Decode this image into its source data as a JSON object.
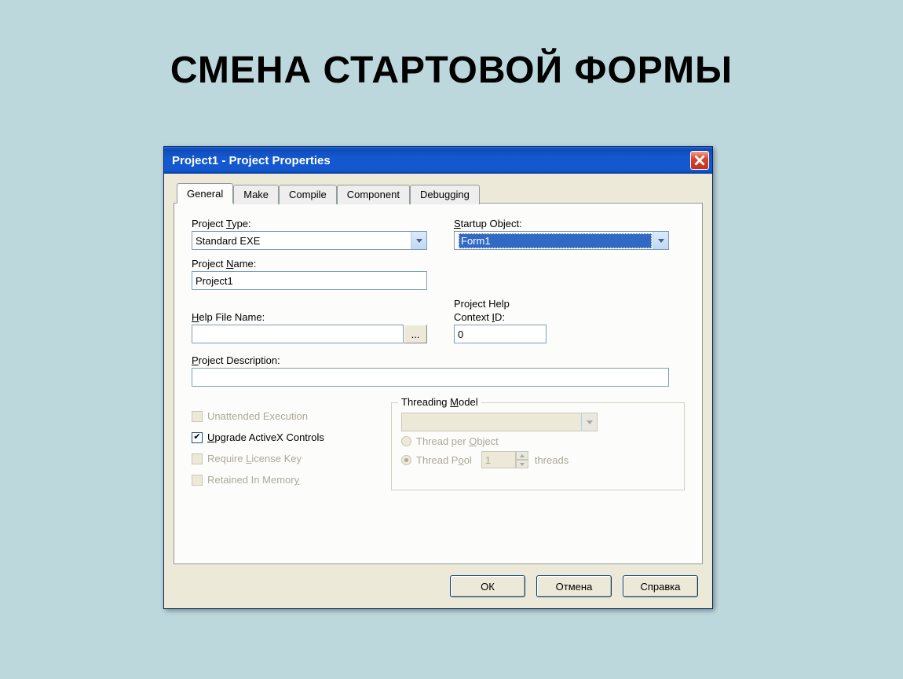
{
  "slide": {
    "title": "СМЕНА СТАРТОВОЙ ФОРМЫ"
  },
  "titlebar": {
    "text": "Project1 - Project Properties"
  },
  "tabs": {
    "general": "General",
    "make": "Make",
    "compile": "Compile",
    "component": "Component",
    "debugging": "Debugging"
  },
  "labels": {
    "project_type": "Project Type:",
    "project_type_u": "T",
    "startup_object": "Startup Object:",
    "startup_object_u": "S",
    "project_name": "Project Name:",
    "project_name_u": "N",
    "help_file_name": "Help File Name:",
    "help_file_u": "H",
    "project_help_context": "Project Help",
    "context_id": "Context ID:",
    "context_id_u": "I",
    "project_description": "Project Description:",
    "project_description_u": "P",
    "unattended": "Unattended Execution",
    "upgrade_activex": "Upgrade ActiveX Controls",
    "upgrade_u": "U",
    "require_license": "Require License Key",
    "require_u": "L",
    "retained": "Retained In Memory",
    "retained_u": "y",
    "threading_model": "Threading Model",
    "threading_u": "M",
    "thread_per_object": "Thread per Object",
    "thread_per_object_u": "O",
    "thread_pool": "Thread Pool",
    "thread_pool_u": "o",
    "threads_suffix": "threads"
  },
  "values": {
    "project_type": "Standard EXE",
    "startup_object": "Form1",
    "project_name": "Project1",
    "help_file_name": "",
    "context_id": "0",
    "project_description": "",
    "thread_pool_count": "1",
    "browse": "...",
    "upgrade_checked": true
  },
  "buttons": {
    "ok": "ОК",
    "cancel": "Отмена",
    "help": "Справка"
  }
}
